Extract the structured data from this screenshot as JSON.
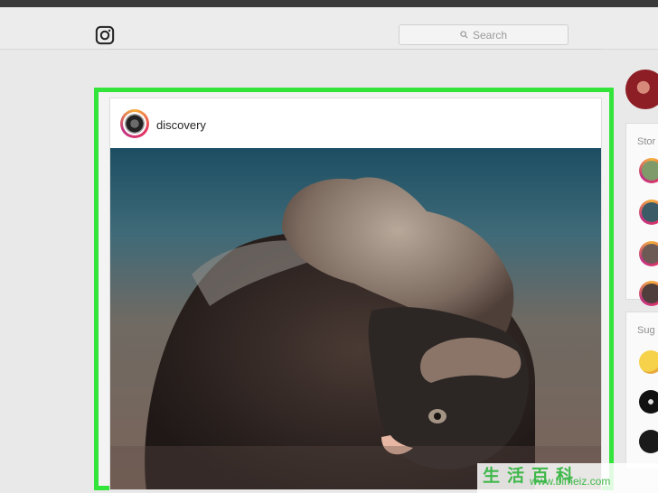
{
  "header": {
    "logo_icon": "instagram-icon",
    "search": {
      "placeholder": "Search",
      "icon": "search-icon"
    }
  },
  "post": {
    "username": "discovery",
    "image_description_icon": "photo-musk-ox"
  },
  "sidebar": {
    "stories_label": "Stor",
    "suggestions_label": "Sug"
  },
  "watermark": {
    "chars": "生活百科",
    "url": "www.bimeiz.com"
  },
  "colors": {
    "highlight_border": "#33e43b",
    "background": "#e9e9e9",
    "story_ring": "#e4355f"
  }
}
